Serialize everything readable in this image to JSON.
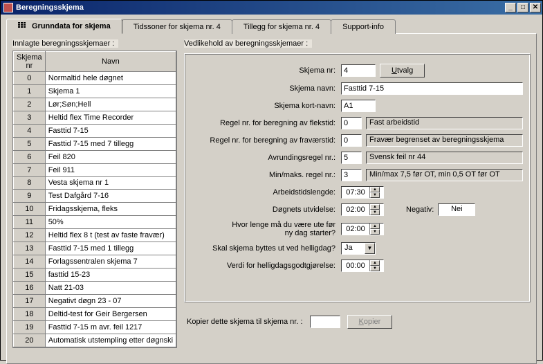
{
  "window": {
    "title": "Beregningsskjema"
  },
  "tabs": {
    "t0": "Grunndata for skjema",
    "t1": "Tidssoner for skjema nr. 4",
    "t2": "Tillegg for skjema nr. 4",
    "t3": "Support-info"
  },
  "left": {
    "section": "Innlagte beregningsskjemaer :",
    "col_nr_1": "Skjema",
    "col_nr_2": "nr",
    "col_name": "Navn",
    "rows": [
      {
        "nr": "0",
        "name": "Normaltid hele døgnet"
      },
      {
        "nr": "1",
        "name": "Skjema 1"
      },
      {
        "nr": "2",
        "name": "Lør;Søn;Hell"
      },
      {
        "nr": "3",
        "name": "Heltid flex Time Recorder"
      },
      {
        "nr": "4",
        "name": "Fasttid 7-15"
      },
      {
        "nr": "5",
        "name": "Fasttid 7-15 med 7 tillegg"
      },
      {
        "nr": "6",
        "name": "Feil 820"
      },
      {
        "nr": "7",
        "name": "Feil 911"
      },
      {
        "nr": "8",
        "name": "Vesta skjema nr 1"
      },
      {
        "nr": "9",
        "name": "Test Dafgård 7-16"
      },
      {
        "nr": "10",
        "name": "Fridagsskjema, fleks"
      },
      {
        "nr": "11",
        "name": "50%"
      },
      {
        "nr": "12",
        "name": "Heltid flex 8 t (test av faste fravær)"
      },
      {
        "nr": "13",
        "name": "Fasttid 7-15 med 1 tillegg"
      },
      {
        "nr": "14",
        "name": "Forlagssentralen skjema 7"
      },
      {
        "nr": "15",
        "name": "fasttid 15-23"
      },
      {
        "nr": "16",
        "name": "Natt 21-03"
      },
      {
        "nr": "17",
        "name": "Negativt døgn 23 - 07"
      },
      {
        "nr": "18",
        "name": "Deltid-test for Geir Bergersen"
      },
      {
        "nr": "19",
        "name": "Fasttid 7-15 m avr. feil 1217"
      },
      {
        "nr": "20",
        "name": "Automatisk utstempling etter døgnski"
      }
    ]
  },
  "right": {
    "section": "Vedlikehold av beregningsskjemaer :",
    "labels": {
      "nr": "Skjema nr:",
      "utvalg": "Utvalg",
      "navn": "Skjema navn:",
      "kort": "Skjema kort-navn:",
      "flekstid": "Regel nr. for beregning av flekstid:",
      "fravaer": "Regel nr. for beregning av fraværstid:",
      "avrund": "Avrundingsregel nr.:",
      "minmaks": "Min/maks. regel nr.:",
      "arblen": "Arbeidstidslengde:",
      "dognutv": "Døgnets utvidelse:",
      "negativ": "Negativ:",
      "hvorlenge1": "Hvor lenge må du være ute før",
      "hvorlenge2": "ny dag starter?",
      "helligbytte": "Skal skjema byttes ut ved helligdag?",
      "helligverdi": "Verdi for helligdagsgodtgjørelse:"
    },
    "values": {
      "nr": "4",
      "navn": "Fasttid 7-15",
      "kort": "A1",
      "flekstid": "0",
      "flekstid_desc": "Fast arbeidstid",
      "fravaer": "0",
      "fravaer_desc": "Fravær begrenset av beregningsskjema",
      "avrund": "5",
      "avrund_desc": "Svensk feil nr 44",
      "minmaks": "3",
      "minmaks_desc": "Min/max 7,5 før OT, min 0,5 OT før OT",
      "arblen": "07:30",
      "dognutv": "02:00",
      "negativ": "Nei",
      "hvorlenge": "02:00",
      "helligbytte": "Ja",
      "helligverdi": "00:00"
    },
    "copy": {
      "label": "Kopier dette skjema til skjema nr. :",
      "value": "",
      "button": "Kopier"
    }
  }
}
